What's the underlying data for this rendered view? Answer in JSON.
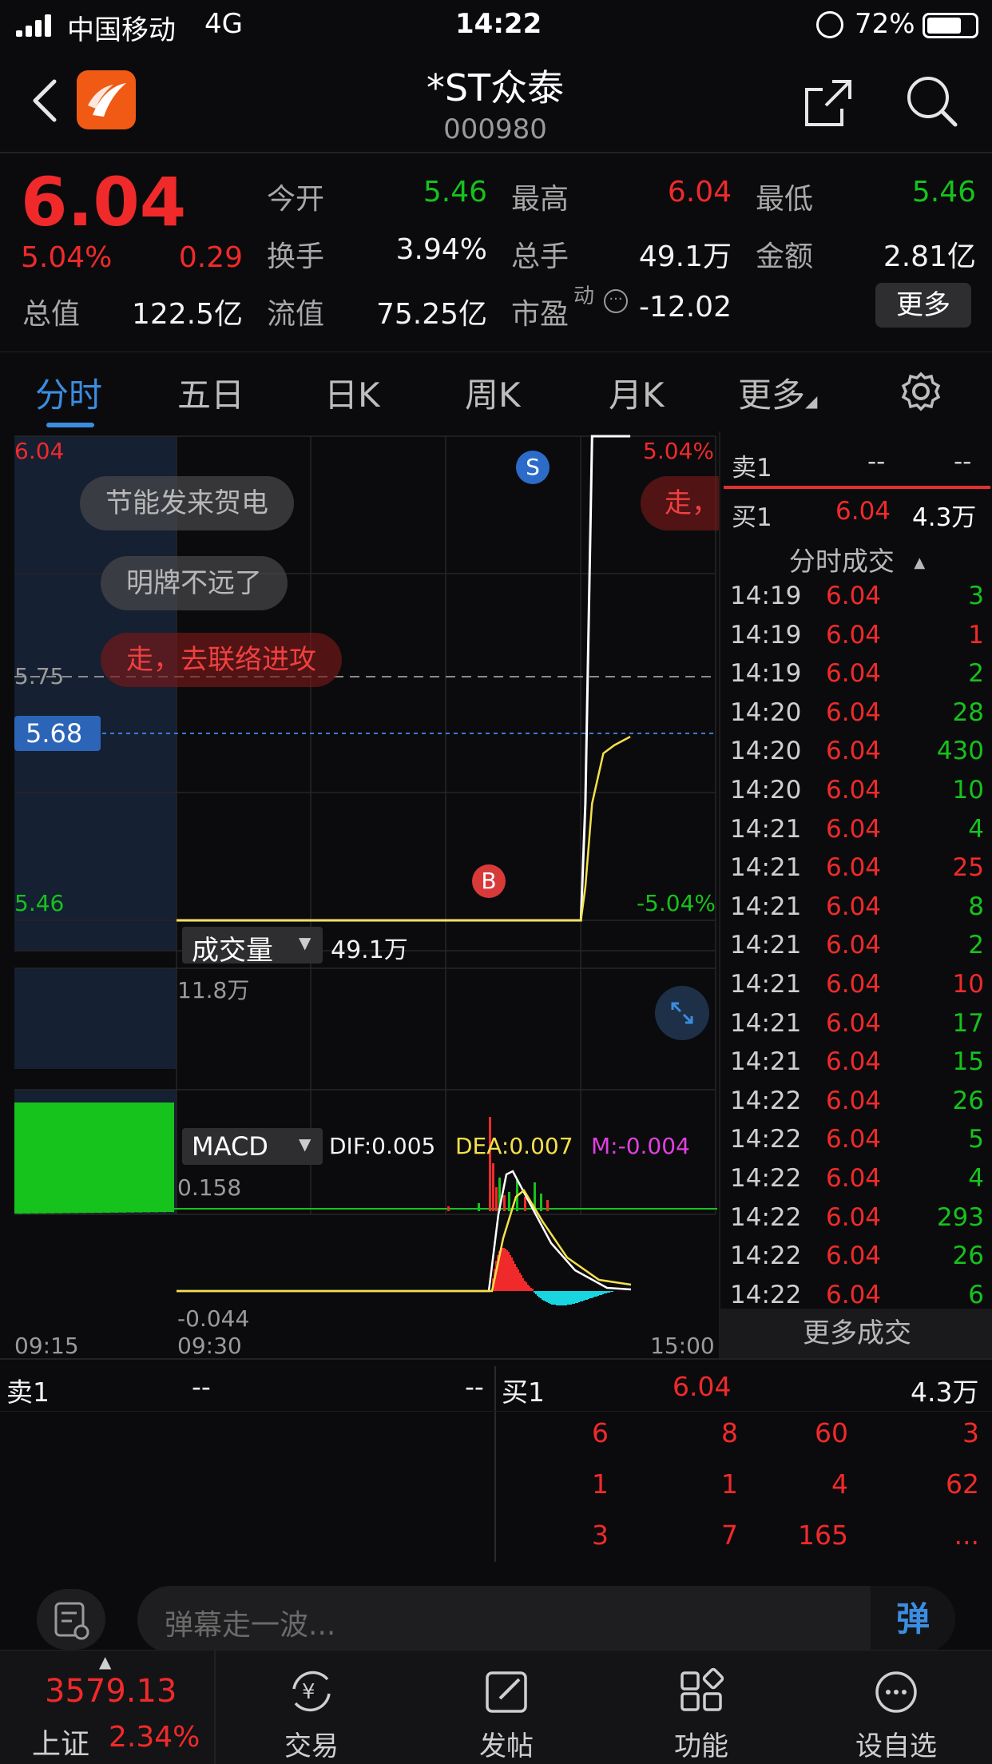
{
  "status_bar": {
    "carrier": "中国移动",
    "network": "4G",
    "time": "14:22",
    "battery": "72%"
  },
  "header": {
    "title": "*ST众泰",
    "code": "000980"
  },
  "quote": {
    "price": "6.04",
    "change_pct": "5.04%",
    "change": "0.29",
    "open_label": "今开",
    "open": "5.46",
    "high_label": "最高",
    "high": "6.04",
    "low_label": "最低",
    "low": "5.46",
    "turnover_label": "换手",
    "turnover": "3.94%",
    "volume_label": "总手",
    "volume": "49.1万",
    "amount_label": "金额",
    "amount": "2.81亿",
    "mktcap_label": "总值",
    "mktcap": "122.5亿",
    "float_label": "流值",
    "float": "75.25亿",
    "pe_label": "市盈",
    "pe_sup": "动",
    "pe": "-12.02",
    "more_button": "更多"
  },
  "tabs": {
    "fenshi": "分时",
    "wuri": "五日",
    "rik": "日K",
    "zhouk": "周K",
    "yuek": "月K",
    "more": "更多"
  },
  "chart": {
    "price_top": "6.04",
    "price_bottom": "5.46",
    "pct_top": "5.04%",
    "pct_bottom": "-5.04%",
    "ref_price": "5.75",
    "avg_price": "5.68",
    "danmaku": [
      "节能发来贺电",
      "明牌不远了",
      "走，去联络进攻",
      "走，"
    ],
    "marker_sell": "S",
    "marker_buy": "B",
    "vol_selector": "成交量",
    "vol_total": "49.1万",
    "vol_max": "11.8万",
    "macd_selector": "MACD",
    "dif": "DIF:0.005",
    "dea": "DEA:0.007",
    "m": "M:-0.004",
    "macd_top": "0.158",
    "macd_bottom": "-0.044",
    "time_start": "09:15",
    "time_open": "09:30",
    "time_end": "15:00",
    "colors": {
      "up": "#f02a2a",
      "down": "#16c21c",
      "avg_line": "#f5e04a",
      "price_line": "#ffffff"
    }
  },
  "chart_data": {
    "type": "line",
    "x": [
      "09:30",
      "11:30",
      "13:00",
      "14:00",
      "14:02",
      "14:05",
      "14:10",
      "14:15",
      "14:22"
    ],
    "series": [
      {
        "values": [
          5.46,
          5.46,
          5.46,
          5.46,
          5.6,
          6.04,
          6.04,
          6.04,
          6.04
        ]
      },
      {
        "values": [
          5.46,
          5.46,
          5.46,
          5.46,
          5.5,
          5.6,
          5.66,
          5.67,
          5.68
        ]
      }
    ],
    "ylim": [
      5.46,
      6.04
    ]
  },
  "side": {
    "ask_label": "卖1",
    "ask_price": "--",
    "ask_vol": "--",
    "bid_label": "买1",
    "bid_price": "6.04",
    "bid_vol": "4.3万",
    "ticks_title": "分时成交",
    "ticks": [
      {
        "t": "14:19",
        "p": "6.04",
        "v": "3"
      },
      {
        "t": "14:19",
        "p": "6.04",
        "v": "1"
      },
      {
        "t": "14:19",
        "p": "6.04",
        "v": "2"
      },
      {
        "t": "14:20",
        "p": "6.04",
        "v": "28"
      },
      {
        "t": "14:20",
        "p": "6.04",
        "v": "430"
      },
      {
        "t": "14:20",
        "p": "6.04",
        "v": "10"
      },
      {
        "t": "14:21",
        "p": "6.04",
        "v": "4"
      },
      {
        "t": "14:21",
        "p": "6.04",
        "v": "25"
      },
      {
        "t": "14:21",
        "p": "6.04",
        "v": "8"
      },
      {
        "t": "14:21",
        "p": "6.04",
        "v": "2"
      },
      {
        "t": "14:21",
        "p": "6.04",
        "v": "10"
      },
      {
        "t": "14:21",
        "p": "6.04",
        "v": "17"
      },
      {
        "t": "14:21",
        "p": "6.04",
        "v": "15"
      },
      {
        "t": "14:22",
        "p": "6.04",
        "v": "26"
      },
      {
        "t": "14:22",
        "p": "6.04",
        "v": "5"
      },
      {
        "t": "14:22",
        "p": "6.04",
        "v": "4"
      },
      {
        "t": "14:22",
        "p": "6.04",
        "v": "293"
      },
      {
        "t": "14:22",
        "p": "6.04",
        "v": "26"
      },
      {
        "t": "14:22",
        "p": "6.04",
        "v": "6"
      }
    ],
    "more_trades": "更多成交"
  },
  "book": {
    "ask_label": "卖1",
    "ask_price": "--",
    "ask_vol": "--",
    "bid_label": "买1",
    "bid_price": "6.04",
    "bid_vol": "4.3万",
    "rows": [
      [
        "6",
        "8",
        "60",
        "3"
      ],
      [
        "1",
        "1",
        "4",
        "62"
      ],
      [
        "3",
        "7",
        "165",
        "..."
      ]
    ]
  },
  "comment": {
    "placeholder": "弹幕走一波...",
    "send": "弹"
  },
  "nav": {
    "index_value": "3579.13",
    "index_name": "上证",
    "index_pct": "2.34%",
    "trade": "交易",
    "post": "发帖",
    "func": "功能",
    "watch": "设自选"
  }
}
